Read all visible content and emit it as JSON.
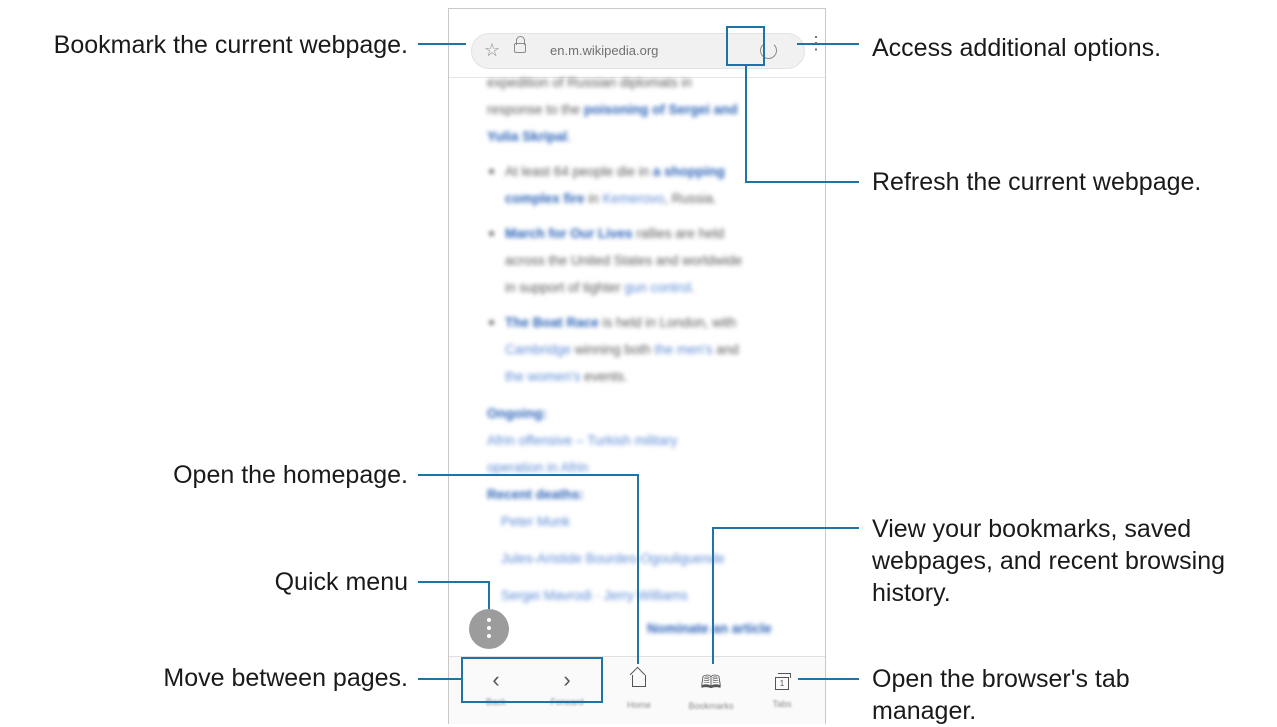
{
  "callouts": {
    "bookmark": "Bookmark the current webpage.",
    "options": "Access additional options.",
    "refresh": "Refresh the current webpage.",
    "homepage": "Open the homepage.",
    "bookmarks_view_1": "View your bookmarks, saved",
    "bookmarks_view_2": "webpages, and recent browsing",
    "bookmarks_view_3": "history.",
    "quick_menu": "Quick menu",
    "move_pages": "Move between pages.",
    "tab_manager_1": "Open the browser's tab",
    "tab_manager_2": "manager."
  },
  "browser": {
    "url": "en.m.wikipedia.org",
    "icons": {
      "bookmark": "star-icon",
      "secure": "lock-icon",
      "refresh": "refresh-icon",
      "more": "more-vertical-icon",
      "quick_menu": "more-vertical-icon",
      "back": "chevron-left-icon",
      "forward": "chevron-right-icon",
      "home": "home-icon",
      "bookmarks": "book-icon",
      "tabs": "tabs-icon"
    },
    "nav": {
      "back_glyph": "‹",
      "forward_glyph": "›",
      "back_label": "Back",
      "forward_label": "Forward",
      "home_label": "Home",
      "bookmarks_label": "Bookmarks",
      "tabs_label": "Tabs",
      "tabs_count": "1"
    },
    "content": {
      "p1": "expedition of Russian diplomats in",
      "p2": "response to the",
      "p2_link": "poisoning of Sergei and",
      "p3_link": "Yulia Skripal",
      "b1a": "At least 64 people die in",
      "b1_link": "a shopping",
      "b1b_link": "complex fire",
      "b1c": "in",
      "b1d": "Kemerovo",
      "b1e": ", Russia.",
      "b2_link": "March for Our Lives",
      "b2a": "rallies are held",
      "b2b": "across the United States and worldwide",
      "b2c": "in support of tighter",
      "b2d": "gun control",
      "b3_link": "The Boat Race",
      "b3a": "is held in London, with",
      "b3b": "Cambridge",
      "b3c": "winning both",
      "b3d": "the men's",
      "b3e": "and",
      "b3f": "the women's",
      "b3g": "events.",
      "ongoing": "Ongoing:",
      "ongoing_1": "Afrin offensive – Turkish military",
      "ongoing_2": "operation in Afrin",
      "deaths": "Recent deaths:",
      "d1": "Peter Munk",
      "d2": "Jules-Aristide Bourdes-Ogouliguende",
      "d3": "Sergei Mavrodi · Jerry Williams",
      "nominate": "Nominate an article"
    }
  },
  "colors": {
    "accent": "#1f74a5"
  }
}
